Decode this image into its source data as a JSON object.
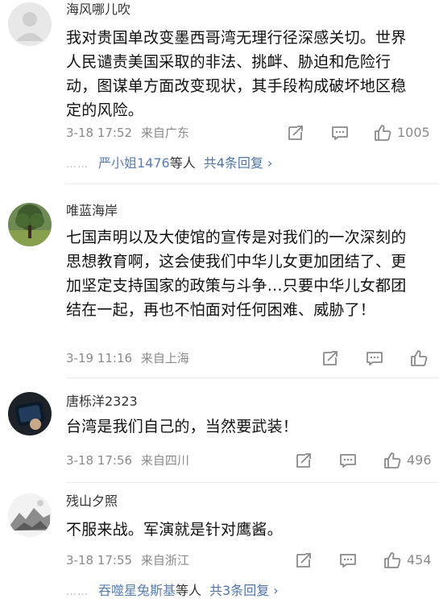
{
  "comments": [
    {
      "username": "海风哪儿吹",
      "text": "我对贵国单改变墨西哥湾无理行径深感关切。世界人民谴责美国采取的非法、挑衅、胁迫和危险行动，图谋单方面改变现状，其手段构成破坏地区稳定的风险。",
      "time": "3-18 17:52",
      "location": "来自广东",
      "likes": "1005",
      "replies": {
        "dots": "……",
        "who": "严小姐1476",
        "etc": "等人",
        "more": "共4条回复 ›"
      }
    },
    {
      "username": "唯蓝海岸",
      "text": "七国声明以及大使馆的宣传是对我们的一次深刻的思想教育啊，这会使我们中华儿女更加团结了、更加坚定支持国家的政策与斗争…只要中华儿女都团结在一起，再也不怕面对任何困难、威胁了！",
      "time": "3-19 11:16",
      "location": "来自上海",
      "likes": ""
    },
    {
      "username": "唐栎洋2323",
      "text": "台湾是我们自己的，当然要武装！",
      "time": "3-18 17:56",
      "location": "来自四川",
      "likes": "496"
    },
    {
      "username": "残山夕照",
      "text": "不服来战。军演就是针对鹰酱。",
      "time": "3-18 17:55",
      "location": "来自浙江",
      "likes": "454",
      "replies": {
        "dots": "……",
        "who": "吞噬星兔斯基",
        "etc": "等人",
        "more": "共3条回复 ›"
      }
    }
  ],
  "icons": {
    "repost": "share-edit-icon",
    "comment": "comment-icon",
    "like": "thumbs-up-icon"
  }
}
